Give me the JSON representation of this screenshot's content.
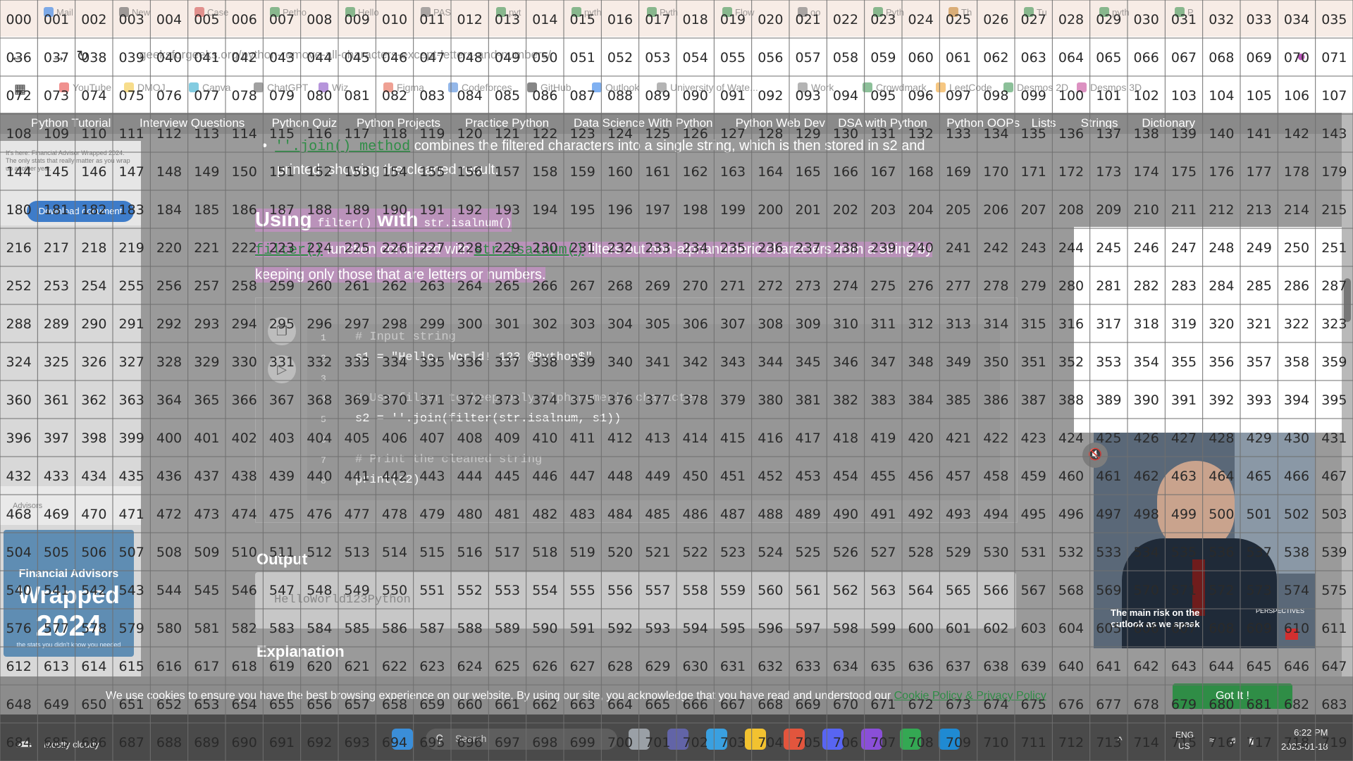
{
  "browser": {
    "tabs": [
      {
        "label": "Mail",
        "color": "#1a73e8"
      },
      {
        "label": "New",
        "color": "#555555"
      },
      {
        "label": "Case",
        "color": "#d04545"
      },
      {
        "label": "Petho",
        "color": "#2f8d46"
      },
      {
        "label": "Hello",
        "color": "#2f8d46"
      },
      {
        "label": "PAS",
        "color": "#6b6b6b"
      },
      {
        "label": "pyt",
        "color": "#2f8d46"
      },
      {
        "label": "pyth",
        "color": "#2f8d46"
      },
      {
        "label": "Pyth",
        "color": "#2f8d46"
      },
      {
        "label": "Flow",
        "color": "#2f8d46"
      },
      {
        "label": "oo",
        "color": "#6b6b6b"
      },
      {
        "label": "Pyth",
        "color": "#2f8d46"
      },
      {
        "label": "Th",
        "color": "#c47a1d"
      },
      {
        "label": "Tu",
        "color": "#2f8d46"
      },
      {
        "label": "pyth",
        "color": "#2f8d46"
      },
      {
        "label": "P",
        "color": "#2f8d46"
      }
    ],
    "url": "geeksforgeeks.org/python-remove-all-characters-except-letters-and-numbers/",
    "bookmarks": [
      {
        "label": "YouTube",
        "color": "#e53935"
      },
      {
        "label": "DMOJ",
        "color": "#f2c230"
      },
      {
        "label": "Canva",
        "color": "#1fa3c9"
      },
      {
        "label": "ChatGPT",
        "color": "#555555"
      },
      {
        "label": "Wiz",
        "color": "#7b3fbf"
      },
      {
        "label": "Figma",
        "color": "#e2553d"
      },
      {
        "label": "Codeforces",
        "color": "#3b7dd8"
      },
      {
        "label": "GitHub",
        "color": "#222222"
      },
      {
        "label": "Outlook",
        "color": "#1a73e8"
      },
      {
        "label": "University of Wate...",
        "color": "#777777"
      },
      {
        "label": "Work",
        "color": "#777777"
      },
      {
        "label": "Crowdmark",
        "color": "#2f8d46"
      },
      {
        "label": "LeetCode",
        "color": "#f09b1d"
      },
      {
        "label": "Desmos 2D",
        "color": "#2f8d46"
      },
      {
        "label": "Desmos 3D",
        "color": "#c0398f"
      }
    ]
  },
  "site_nav": [
    "Python Tutorial",
    "Interview Questions",
    "Python Quiz",
    "Python Projects",
    "Practice Python",
    "Data Science With Python",
    "Python Web Dev",
    "DSA with Python",
    "Python OOPs",
    "Lists",
    "Strings",
    "Dictionary"
  ],
  "article": {
    "bullet_link": "''.join() method",
    "bullet_rest": " combines the filtered characters into a single string, which is then stored in s2 and",
    "bullet_line2": "printed, showing the cleaned result.",
    "heading_main1": "Using ",
    "heading_code1": "filter()",
    "heading_main2": " with ",
    "heading_code2": "str.isalnum()",
    "para_link1": "filter()",
    "para_text1": " function combined with ",
    "para_link2": "str.isalnum()",
    "para_text2": " filters out non-alphanumeric characters from a string by",
    "para_line2": "keeping only those that are letters or numbers.",
    "code_lines": [
      {
        "n": "1",
        "text": "# Input string",
        "cmt": true
      },
      {
        "n": "2",
        "text": "s1 = \"Hello, World! 123 @Python$\"",
        "cmt": false
      },
      {
        "n": "3",
        "text": "",
        "cmt": false
      },
      {
        "n": "4",
        "text": "# Use filter to keep only alphanumeric characters",
        "cmt": true
      },
      {
        "n": "5",
        "text": "s2 = ''.join(filter(str.isalnum, s1))",
        "cmt": false
      },
      {
        "n": "6",
        "text": "",
        "cmt": false
      },
      {
        "n": "7",
        "text": "# Print the cleaned string",
        "cmt": true
      },
      {
        "n": "8",
        "text": "print(s2)",
        "cmt": false
      }
    ],
    "output_heading": "Output",
    "output_text": "HelloWorld123Python",
    "explanation_heading": "Explanation"
  },
  "ads": {
    "left_note": "It's here: Financial Advisor Wrapped 2024. The only stats that really matter as you wrap up another year.",
    "download_label": "Download document",
    "brand_label": "Advisors",
    "wrapped_l1": "Financial Advisors",
    "wrapped_l2": "Wrapped",
    "wrapped_l3": "2024",
    "wrapped_l4": "the stats you didn't know you needed",
    "video_caption": "The main risk on the outlook as we speak",
    "video_brand": "PERSPECTIVES"
  },
  "cookie": {
    "text": "We use cookies to ensure you have the best browsing experience on our website. By using our site, you acknowledge that you have read and understood our ",
    "link": "Cookie Policy & Privacy Policy",
    "button": "Got It !"
  },
  "taskbar": {
    "weather": "Mostly cloudy",
    "search_placeholder": "Search",
    "lang": "ENG",
    "region": "US",
    "time": "6:22 PM",
    "date": "2025-01-18",
    "apps": [
      {
        "name": "files-app",
        "color": "#9aa0a6"
      },
      {
        "name": "teams-app",
        "color": "#6264a7"
      },
      {
        "name": "copilot-app",
        "color": "#3aa0e0"
      },
      {
        "name": "explorer-app",
        "color": "#f2c230"
      },
      {
        "name": "chrome-app",
        "color": "#e2553d"
      },
      {
        "name": "discord-app",
        "color": "#5865f2"
      },
      {
        "name": "app-purple",
        "color": "#8a4fd8"
      },
      {
        "name": "chrome-app-2",
        "color": "#34a853"
      },
      {
        "name": "vscode-app",
        "color": "#1f8ad2"
      }
    ]
  },
  "grid": {
    "cols": 36,
    "rows": 20,
    "start": 0
  }
}
